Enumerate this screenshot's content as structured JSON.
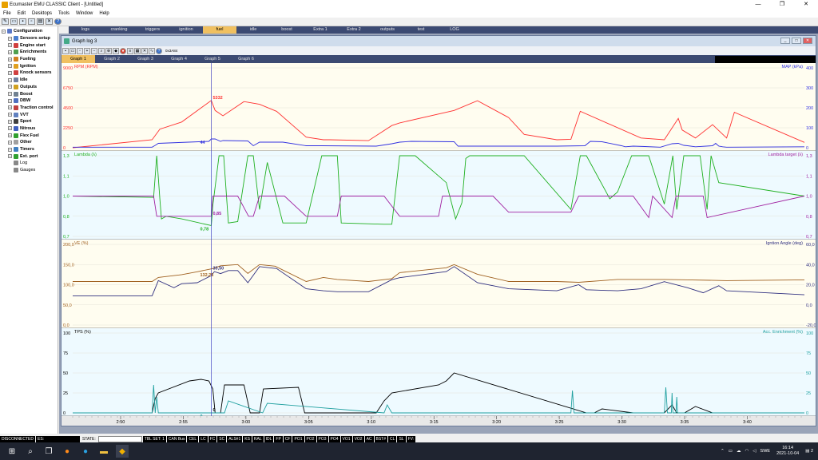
{
  "window": {
    "title": "Ecumaster EMU CLASSIC Client - [Untitled]"
  },
  "menu": [
    "File",
    "Edit",
    "Desktops",
    "Tools",
    "Window",
    "Help"
  ],
  "tabs": {
    "items": [
      "logs",
      "cranking",
      "triggers",
      "ignition",
      "fuel",
      "idle",
      "boost",
      "Extra 1",
      "Extra 2",
      "outputs",
      "test",
      "LOG"
    ],
    "active": "fuel"
  },
  "tree": [
    {
      "label": "Configuration",
      "icon": "gear-icon",
      "color": "#5a78c8",
      "bold": true,
      "root": true
    },
    {
      "label": "Sensors setup",
      "icon": "thermometer-icon",
      "color": "#4a7fd0",
      "bold": true
    },
    {
      "label": "Engine start",
      "icon": "key-icon",
      "color": "#d04040",
      "bold": true
    },
    {
      "label": "Enrichments",
      "icon": "table-icon",
      "color": "#50a050",
      "bold": true
    },
    {
      "label": "Fueling",
      "icon": "fuel-icon",
      "color": "#d08020",
      "bold": true
    },
    {
      "label": "Ignition",
      "icon": "spark-icon",
      "color": "#e0a020",
      "bold": true
    },
    {
      "label": "Knock sensors",
      "icon": "knock-icon",
      "color": "#d04040",
      "bold": true
    },
    {
      "label": "Idle",
      "icon": "idle-icon",
      "color": "#7080a0",
      "bold": true
    },
    {
      "label": "Outputs",
      "icon": "outputs-icon",
      "color": "#d0a020",
      "bold": true
    },
    {
      "label": "Boost",
      "icon": "turbo-icon",
      "color": "#708090",
      "bold": true
    },
    {
      "label": "DBW",
      "icon": "throttle-icon",
      "color": "#5070c0",
      "bold": true
    },
    {
      "label": "Traction control",
      "icon": "traction-icon",
      "color": "#c04040",
      "bold": true
    },
    {
      "label": "VVT",
      "icon": "cam-icon",
      "color": "#6080c0",
      "bold": true
    },
    {
      "label": "Sport",
      "icon": "flag-icon",
      "color": "#404040",
      "bold": true
    },
    {
      "label": "Nitrous",
      "icon": "nitrous-icon",
      "color": "#4060c0",
      "bold": true
    },
    {
      "label": "Flex Fuel",
      "icon": "flexfuel-icon",
      "color": "#30a030",
      "bold": true
    },
    {
      "label": "Other",
      "icon": "other-icon",
      "color": "#a0a0a0",
      "bold": true
    },
    {
      "label": "Timers",
      "icon": "timer-icon",
      "color": "#4080c0",
      "bold": true
    },
    {
      "label": "Ext. port",
      "icon": "port-icon",
      "color": "#30a030",
      "bold": true
    },
    {
      "label": "Log",
      "icon": "log-icon",
      "color": "#888888",
      "bold": false
    },
    {
      "label": "Gauges",
      "icon": "gauge-icon",
      "color": "#888888",
      "bold": false
    }
  ],
  "graph_window": {
    "title": "Graph log 3",
    "toolbar_value": "0x3A84",
    "tabs": [
      "Graph 1",
      "Graph 2",
      "Graph 3",
      "Graph 4",
      "Graph 5",
      "Graph 6"
    ],
    "active_tab": "Graph 1"
  },
  "colors": {
    "rpm": "#ff3030",
    "map": "#3030e0",
    "lambda": "#20b020",
    "lambda_target": "#a020a0",
    "ve": "#a06020",
    "ign": "#303080",
    "tps": "#000000",
    "acc": "#20a0a0"
  },
  "chart_data": [
    {
      "type": "line",
      "panel": "rpm_map",
      "left_label": "RPM (RPM)",
      "right_label": "MAP (kPa)",
      "left_ticks": [
        "9000",
        "6750",
        "4500",
        "2250",
        "0"
      ],
      "right_ticks": [
        "400",
        "300",
        "200",
        "100",
        "0"
      ],
      "ylim_left": [
        0,
        9000
      ],
      "ylim_right": [
        0,
        400
      ],
      "cursor_labels": [
        {
          "value": "5332",
          "series": "rpm"
        },
        {
          "value": "44",
          "series": "map"
        }
      ],
      "series": [
        {
          "name": "RPM (RPM)",
          "color": "#ff3030",
          "axis": "left",
          "x": [
            0,
            102,
            112,
            140,
            178,
            183,
            193,
            220,
            240,
            262,
            300,
            322,
            330,
            380,
            410,
            420,
            490,
            520,
            560,
            580,
            622,
            640,
            652,
            730,
            760,
            778,
            783,
            800,
            822,
            840,
            850,
            940
          ],
          "y": [
            0,
            900,
            2100,
            2900,
            5332,
            4200,
            3600,
            5200,
            4900,
            4100,
            1200,
            900,
            900,
            800,
            2500,
            2800,
            4200,
            5300,
            3400,
            1500,
            900,
            950,
            4100,
            1100,
            900,
            3300,
            2000,
            1100,
            2600,
            1100,
            4000,
            600
          ]
        },
        {
          "name": "MAP (kPa)",
          "color": "#3030e0",
          "axis": "right",
          "x": [
            0,
            102,
            106,
            110,
            175,
            178,
            183,
            190,
            193,
            225,
            232,
            240,
            270,
            300,
            320,
            390,
            410,
            420,
            435,
            490,
            495,
            540,
            560,
            622,
            658,
            665,
            680,
            705,
            710,
            720,
            735,
            755,
            770,
            778,
            785,
            790,
            800,
            822,
            826,
            830,
            835,
            840,
            940
          ],
          "y": [
            3,
            3,
            12,
            22,
            32,
            44,
            44,
            32,
            36,
            34,
            10,
            28,
            28,
            10,
            10,
            8,
            20,
            28,
            32,
            30,
            8,
            8,
            8,
            8,
            10,
            32,
            30,
            10,
            5,
            8,
            6,
            3,
            20,
            22,
            12,
            10,
            5,
            10,
            22,
            8,
            5,
            3,
            5
          ]
        }
      ]
    },
    {
      "type": "line",
      "panel": "lambda",
      "left_label": "Lambda (λ)",
      "right_label": "Lambda target (λ)",
      "left_ticks": [
        "1,3",
        "1,1",
        "1,0",
        "0,8",
        "0,7"
      ],
      "right_ticks": [
        "1,3",
        "1,1",
        "1,0",
        "0,8",
        "0,7"
      ],
      "ylim_left": [
        0.7,
        1.3
      ],
      "ylim_right": [
        0.7,
        1.3
      ],
      "cursor_labels": [
        {
          "value": "0,85",
          "series": "lambda_target"
        },
        {
          "value": "0,78",
          "series": "lambda"
        }
      ],
      "series": [
        {
          "name": "Lambda (λ)",
          "color": "#20b020",
          "axis": "left",
          "x": [
            0,
            104,
            108,
            112,
            114,
            120,
            140,
            178,
            180,
            188,
            194,
            200,
            212,
            225,
            232,
            240,
            250,
            270,
            300,
            320,
            340,
            345,
            400,
            410,
            420,
            440,
            480,
            492,
            500,
            505,
            510,
            520,
            580,
            640,
            652,
            660,
            690,
            700,
            718,
            740,
            760,
            771,
            776,
            785,
            806,
            815,
            820,
            830,
            940
          ],
          "y": [
            1.0,
            0.99,
            1.3,
            0.98,
            0.83,
            0.85,
            0.83,
            0.78,
            0.93,
            1.3,
            1.3,
            0.8,
            0.81,
            1.3,
            1.3,
            0.9,
            1.25,
            0.8,
            0.8,
            1.3,
            1.3,
            0.8,
            0.79,
            0.79,
            1.3,
            1.3,
            1.1,
            0.83,
            0.95,
            1.28,
            1.3,
            1.3,
            1.3,
            0.9,
            1.3,
            1.3,
            0.98,
            1.03,
            1.3,
            1.3,
            0.94,
            1.3,
            0.9,
            1.3,
            1.3,
            0.9,
            1.3,
            1.1,
            1.0
          ]
        },
        {
          "name": "Lambda target (λ)",
          "color": "#a020a0",
          "axis": "right",
          "x": [
            0,
            104,
            108,
            178,
            180,
            212,
            226,
            232,
            240,
            272,
            300,
            340,
            345,
            400,
            420,
            470,
            475,
            540,
            560,
            640,
            650,
            720,
            740,
            745,
            770,
            775,
            810,
            815,
            940
          ],
          "y": [
            1.0,
            1.0,
            0.85,
            0.85,
            1.0,
            1.0,
            0.85,
            0.85,
            1.0,
            1.0,
            0.85,
            0.85,
            1.0,
            1.0,
            0.85,
            0.85,
            1.0,
            1.0,
            0.88,
            0.88,
            1.0,
            1.0,
            0.84,
            1.0,
            0.84,
            1.0,
            1.0,
            0.84,
            1.0
          ]
        }
      ]
    },
    {
      "type": "line",
      "panel": "ve_ign",
      "left_label": "VE (%)",
      "right_label": "Igntion Angle (deg)",
      "left_ticks": [
        "200,0",
        "150,0",
        "100,0",
        "50,0",
        "0,0"
      ],
      "right_ticks": [
        "60,0",
        "40,0",
        "20,0",
        "0,0",
        "-20,0"
      ],
      "ylim_left": [
        0,
        200
      ],
      "ylim_right": [
        -20,
        60
      ],
      "cursor_labels": [
        {
          "value": "33,50",
          "series": "ign"
        },
        {
          "value": "132,25",
          "series": "ve"
        }
      ],
      "series": [
        {
          "name": "VE (%)",
          "color": "#a06020",
          "axis": "left",
          "x": [
            0,
            102,
            110,
            140,
            160,
            180,
            190,
            212,
            225,
            240,
            260,
            300,
            322,
            340,
            380,
            410,
            420,
            480,
            490,
            520,
            560,
            622,
            650,
            700,
            760,
            790,
            840,
            940
          ],
          "y": [
            108,
            108,
            118,
            125,
            132,
            140,
            147,
            150,
            128,
            150,
            146,
            108,
            118,
            113,
            108,
            115,
            130,
            142,
            150,
            126,
            108,
            108,
            106,
            113,
            113,
            112,
            110,
            112
          ]
        },
        {
          "name": "Igntion Angle (deg)",
          "color": "#303080",
          "axis": "right",
          "x": [
            0,
            102,
            110,
            130,
            140,
            160,
            178,
            182,
            190,
            200,
            212,
            225,
            240,
            262,
            300,
            322,
            340,
            380,
            410,
            420,
            480,
            490,
            520,
            560,
            622,
            650,
            660,
            700,
            730,
            760,
            790,
            810,
            830,
            840,
            940
          ],
          "y": [
            9,
            9,
            24,
            17,
            21,
            22,
            29,
            33,
            31,
            34,
            34,
            22,
            38,
            36,
            16,
            14,
            13,
            13,
            25,
            27,
            33,
            38,
            22,
            16,
            14,
            20,
            15,
            14,
            16,
            23,
            17,
            12,
            19,
            14,
            10
          ]
        }
      ]
    },
    {
      "type": "line",
      "panel": "tps_acc",
      "left_label": "TPS (%)",
      "right_label": "Acc. Enrichment (%)",
      "left_ticks": [
        "100",
        "75",
        "50",
        "25",
        "0"
      ],
      "right_ticks": [
        "100",
        "75",
        "50",
        "25",
        "0"
      ],
      "ylim_left": [
        0,
        100
      ],
      "ylim_right": [
        0,
        100
      ],
      "cursor_labels": [
        {
          "value": "0",
          "series": "tps"
        },
        {
          "value": "0",
          "series": "acc"
        }
      ],
      "series": [
        {
          "name": "TPS (%)",
          "color": "#000000",
          "axis": "left",
          "x": [
            0,
            102,
            106,
            110,
            150,
            165,
            175,
            180,
            183,
            190,
            195,
            220,
            228,
            240,
            245,
            290,
            298,
            310,
            390,
            400,
            410,
            470,
            480,
            490,
            660,
            670,
            680,
            720,
            760,
            770,
            776,
            786,
            800,
            822,
            940
          ],
          "y": [
            0,
            0,
            18,
            25,
            40,
            42,
            40,
            30,
            0,
            0,
            35,
            35,
            0,
            0,
            30,
            32,
            0,
            0,
            0,
            15,
            25,
            35,
            40,
            50,
            0,
            0,
            5,
            0,
            0,
            10,
            0,
            0,
            8,
            0,
            0
          ]
        },
        {
          "name": "Acc. Enrichment (%)",
          "color": "#20a0a0",
          "axis": "right",
          "x": [
            0,
            102,
            104,
            106,
            108,
            110,
            150,
            195,
            200,
            244,
            250,
            400,
            404,
            410,
            640,
            642,
            644,
            760,
            762,
            764,
            769,
            770,
            771,
            775,
            776,
            777,
            940
          ],
          "y": [
            0,
            0,
            35,
            0,
            20,
            0,
            0,
            0,
            15,
            0,
            12,
            0,
            10,
            0,
            0,
            28,
            0,
            0,
            32,
            0,
            0,
            25,
            0,
            0,
            20,
            0,
            0
          ]
        }
      ]
    }
  ],
  "x_axis": {
    "ticks": [
      "2:50",
      "2:55",
      "3:00",
      "3:05",
      "3:10",
      "3:15",
      "3:20",
      "3:25",
      "3:30",
      "3:35",
      "3:40"
    ],
    "cursor_label": "0"
  },
  "statusbar": {
    "conn": "DISCONNECTED",
    "es": "ES:",
    "state": "STATE:",
    "flags": [
      "TBL SET: 1",
      "CAN Bus",
      "CEL",
      "LC",
      "FC",
      "SC",
      "ALS#1",
      "KS",
      "RAL",
      "IDL",
      "FP",
      "CF",
      "PO1",
      "PO2",
      "PO3",
      "PO4",
      "VO1",
      "VO2",
      "AC",
      "BST#",
      "CL",
      "SL",
      "FV:"
    ]
  },
  "tray": {
    "lang": "SWE",
    "time": "16:14",
    "date": "2021-10-04",
    "notif": "2"
  }
}
